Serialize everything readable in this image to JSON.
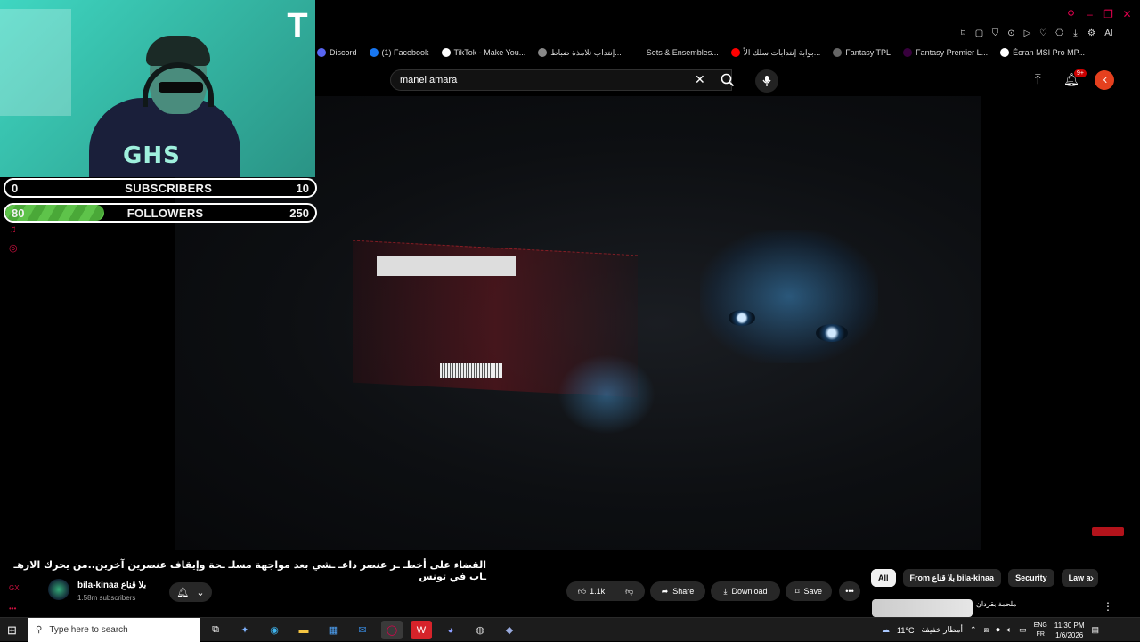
{
  "window_controls": {
    "search": "⚲",
    "minimize": "–",
    "restore": "❐",
    "close": "✕"
  },
  "extensions": [
    "⌑",
    "▢",
    "⛉",
    "⊙",
    "▷",
    "♡",
    "⎔",
    "⤓",
    "⚙"
  ],
  "extensions_ai": "AI",
  "bookmarks": [
    {
      "label": "Discord",
      "color": "#5865f2"
    },
    {
      "label": "(1) Facebook",
      "color": "#1877f2"
    },
    {
      "label": "TikTok - Make You...",
      "color": "#ffffff"
    },
    {
      "label": "إنتداب تلامذة ضباط...",
      "color": "#888888"
    },
    {
      "label": "Sets & Ensembles...",
      "color": "#00000000"
    },
    {
      "label": "بوابة إنتدابات سلك الأ...",
      "color": "#ff0000"
    },
    {
      "label": "Fantasy TPL",
      "color": "#666666"
    },
    {
      "label": "Fantasy Premier L...",
      "color": "#37003c"
    },
    {
      "label": "Écran MSI Pro MP...",
      "color": "#ffffff"
    }
  ],
  "header": {
    "search_value": "manel amara",
    "notif_badge": "9+",
    "avatar_letter": "k"
  },
  "overlay": {
    "logo": "T",
    "shirt_text": "GHS",
    "subscribers": {
      "current": "0",
      "label": "SUBSCRIBERS",
      "goal": "10",
      "progress": 0.0
    },
    "followers": {
      "current": "80",
      "label": "FOLLOWERS",
      "goal": "250",
      "progress": 0.32
    }
  },
  "video": {
    "title": "القضاء على أخطـ ـر عنصر داعـ ـشي بعد مواجهة مسلـ ـحة وإيقاف عنصرين آخرين..من يحرك الارهـ ـاب في تونس",
    "channel_name": "bila-kinaa بلا قناع",
    "channel_subs": "1.58m subscribers",
    "likes": "1.1k",
    "share_label": "Share",
    "download_label": "Download",
    "save_label": "Save"
  },
  "chips": [
    {
      "label": "All",
      "active": true
    },
    {
      "label": "From بلا قناع bila-kinaa",
      "active": false
    },
    {
      "label": "Security",
      "active": false
    },
    {
      "label": "Law a",
      "active": false
    }
  ],
  "recommendation": {
    "title": "ملحمة بقردان"
  },
  "taskbar": {
    "search_placeholder": "Type here to search",
    "weather": "11°C",
    "weather_text": "أمطار خفيفة",
    "lang_top": "ENG",
    "lang_bottom": "FR",
    "time": "11:30 PM",
    "date": "1/6/2026"
  }
}
